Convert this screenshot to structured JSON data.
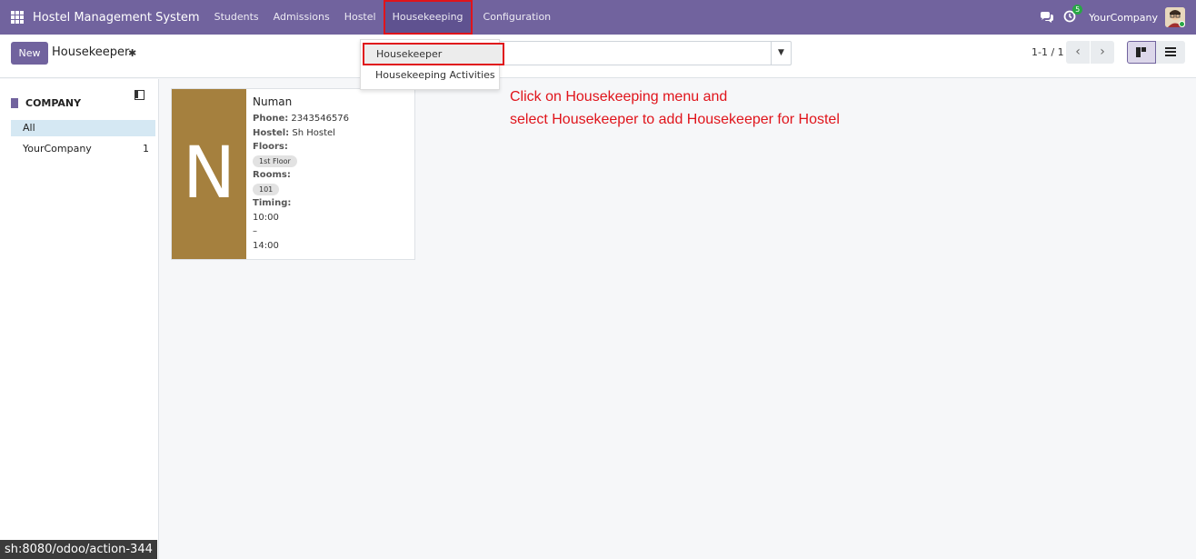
{
  "navbar": {
    "app_name": "Hostel Management System",
    "menu": [
      {
        "label": "Students"
      },
      {
        "label": "Admissions"
      },
      {
        "label": "Hostel"
      },
      {
        "label": "Housekeeping"
      },
      {
        "label": "Configuration"
      }
    ],
    "activity_badge": "5",
    "company": "YourCompany"
  },
  "control_panel": {
    "new_label": "New",
    "breadcrumb": "Housekeeper",
    "pager": "1-1 / 1"
  },
  "dropdown": {
    "items": [
      {
        "label": "Housekeeper"
      },
      {
        "label": "Housekeeping Activities"
      }
    ]
  },
  "sidebar": {
    "header": "COMPANY",
    "items": [
      {
        "label": "All",
        "count": ""
      },
      {
        "label": "YourCompany",
        "count": "1"
      }
    ]
  },
  "card": {
    "initial": "N",
    "name": "Numan",
    "phone_label": "Phone:",
    "phone": "2343546576",
    "hostel_label": "Hostel:",
    "hostel": "Sh Hostel",
    "floors_label": "Floors:",
    "floor_tag": "1st Floor",
    "rooms_label": "Rooms:",
    "room_tag": "101",
    "timing_label": "Timing:",
    "timing_start": "10:00",
    "timing_sep": "–",
    "timing_end": "14:00"
  },
  "instruction": {
    "line1": "Click on Housekeeping menu and",
    "line2": "select Housekeeper to add Housekeeper for Hostel"
  },
  "status_url": "sh:8080/odoo/action-344",
  "colors": {
    "brand": "#71639e",
    "highlight": "#e0141b",
    "avatar_bg": "#a5803e"
  }
}
